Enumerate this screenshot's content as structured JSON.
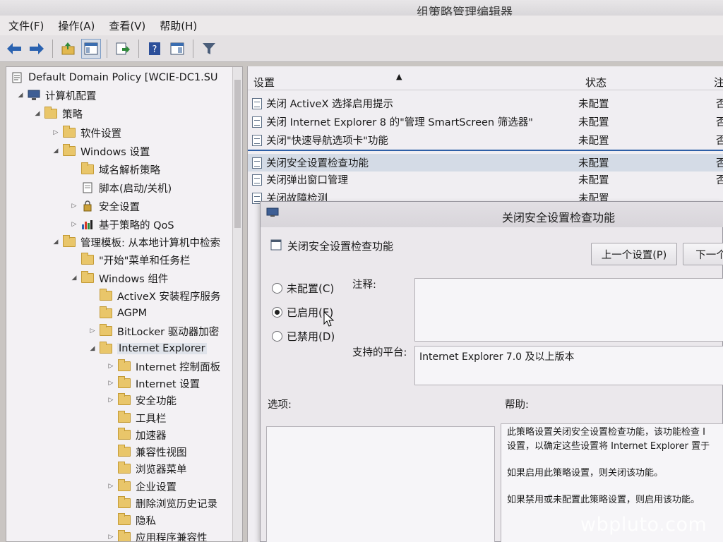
{
  "window": {
    "title": "组策略管理编辑器"
  },
  "menu": [
    "文件(F)",
    "操作(A)",
    "查看(V)",
    "帮助(H)"
  ],
  "toolbar_icons": [
    "back-icon",
    "forward-icon",
    "up-folder-icon",
    "show-hide-tree-icon",
    "export-list-icon",
    "help-icon",
    "properties-icon",
    "filter-icon"
  ],
  "tree": {
    "root": "Default Domain Policy [WCIE-DC1.SU",
    "items": [
      "计算机配置",
      "策略",
      "软件设置",
      "Windows 设置",
      "域名解析策略",
      "脚本(启动/关机)",
      "安全设置",
      "基于策略的 QoS",
      "管理模板: 从本地计算机中检索",
      "\"开始\"菜单和任务栏",
      "Windows 组件",
      "ActiveX 安装程序服务",
      "AGPM",
      "BitLocker 驱动器加密",
      "Internet Explorer",
      "Internet 控制面板",
      "Internet 设置",
      "安全功能",
      "工具栏",
      "加速器",
      "兼容性视图",
      "浏览器菜单",
      "企业设置",
      "删除浏览历史记录",
      "隐私",
      "应用程序兼容性"
    ]
  },
  "list": {
    "headers": {
      "setting": "设置",
      "state": "状态",
      "note": "注"
    },
    "rows": [
      {
        "name": "关闭 ActiveX 选择启用提示",
        "state": "未配置",
        "note": "否"
      },
      {
        "name": "关闭 Internet Explorer 8 的\"管理 SmartScreen 筛选器\"",
        "state": "未配置",
        "note": "否"
      },
      {
        "name": "关闭\"快速导航选项卡\"功能",
        "state": "未配置",
        "note": "否"
      },
      {
        "name": "关闭安全设置检查功能",
        "state": "未配置",
        "note": "否"
      },
      {
        "name": "关闭弹出窗口管理",
        "state": "未配置",
        "note": "否"
      },
      {
        "name": "关闭故障检测",
        "state": "未配置",
        "note": ""
      }
    ]
  },
  "dialog": {
    "title": "关闭安全设置检查功能",
    "subtitle": "关闭安全设置检查功能",
    "prev_button": "上一个设置(P)",
    "next_button": "下一个",
    "radio_not_configured": "未配置(C)",
    "radio_enabled": "已启用(E)",
    "radio_disabled": "已禁用(D)",
    "selected": "enabled",
    "comment_label": "注释:",
    "platform_label": "支持的平台:",
    "platform_value": "Internet Explorer 7.0 及以上版本",
    "options_label": "选项:",
    "help_label": "帮助:",
    "help_lines": [
      "此策略设置关闭安全设置检查功能，该功能检查 I",
      "设置，以确定这些设置将 Internet Explorer 置于",
      "如果启用此策略设置，则关闭该功能。",
      "如果禁用或未配置此策略设置，则启用该功能。"
    ]
  },
  "watermark": "wbpluto.com",
  "colors": {
    "accent": "#2e5fa7",
    "selection": "#d4dbe6"
  }
}
